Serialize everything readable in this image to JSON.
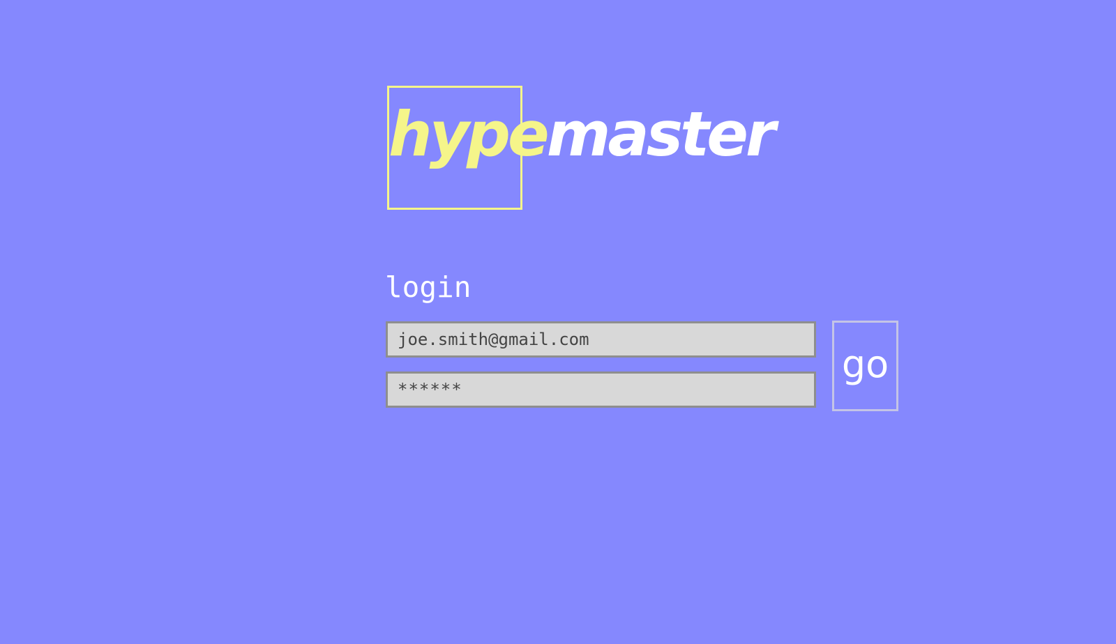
{
  "theme": {
    "background": "#8588fe",
    "accent": "#f5f58a",
    "text": "#ffffff",
    "field_background": "#d8d8d8",
    "field_border": "#8e8e8e",
    "button_border": "#c4c4e6"
  },
  "logo": {
    "part1": "hype",
    "part2": "master"
  },
  "login": {
    "heading": "login",
    "email_value": "joe.smith@gmail.com",
    "password_value": "******",
    "submit_label": "go"
  }
}
